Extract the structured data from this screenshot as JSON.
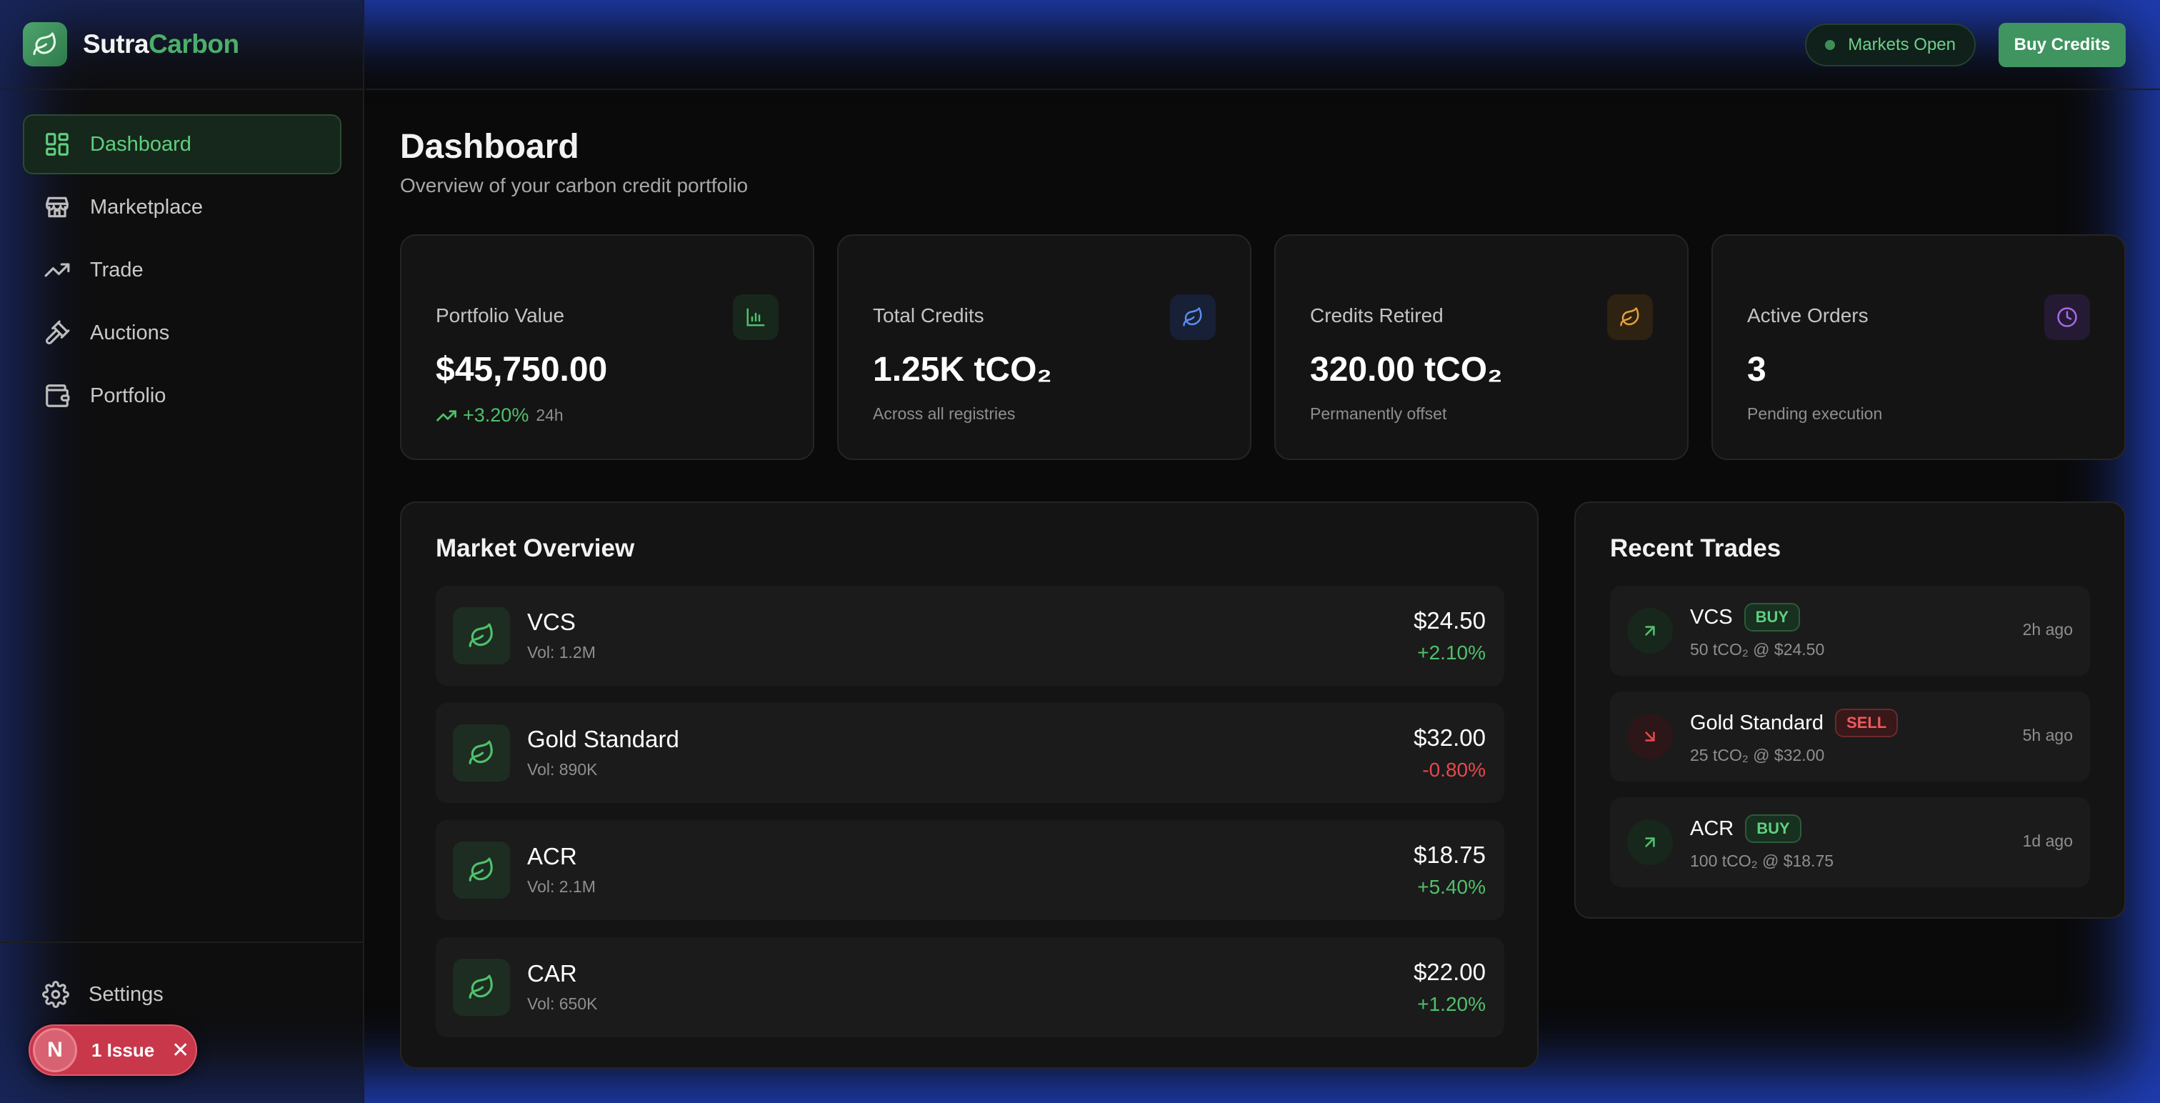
{
  "brand": {
    "name_part1": "Sutra",
    "name_part2": "Carbon"
  },
  "sidebar": {
    "items": [
      {
        "label": "Dashboard",
        "icon": "dashboard-icon",
        "active": true
      },
      {
        "label": "Marketplace",
        "icon": "store-icon",
        "active": false
      },
      {
        "label": "Trade",
        "icon": "trending-up-icon",
        "active": false
      },
      {
        "label": "Auctions",
        "icon": "gavel-icon",
        "active": false
      },
      {
        "label": "Portfolio",
        "icon": "wallet-icon",
        "active": false
      }
    ],
    "settings_label": "Settings"
  },
  "issue_badge": {
    "letter": "N",
    "label": "1 Issue",
    "close": "✕"
  },
  "topbar": {
    "market_status": "Markets Open",
    "buy_button": "Buy Credits"
  },
  "page": {
    "title": "Dashboard",
    "subtitle": "Overview of your carbon credit portfolio"
  },
  "stats": [
    {
      "label": "Portfolio Value",
      "value": "$45,750.00",
      "change": "+3.20%",
      "period": "24h",
      "icon": "bar-chart-icon",
      "color": "#4fc06b"
    },
    {
      "label": "Total Credits",
      "value": "1.25K tCO₂",
      "sub": "Across all registries",
      "icon": "leaf-icon",
      "color": "#5b8def"
    },
    {
      "label": "Credits Retired",
      "value": "320.00 tCO₂",
      "sub": "Permanently offset",
      "icon": "leaf-icon",
      "color": "#e3a23a"
    },
    {
      "label": "Active Orders",
      "value": "3",
      "sub": "Pending execution",
      "icon": "clock-icon",
      "color": "#a46ae8"
    }
  ],
  "market_overview": {
    "title": "Market Overview",
    "rows": [
      {
        "name": "VCS",
        "vol": "Vol: 1.2M",
        "price": "$24.50",
        "change": "+2.10%",
        "direction": "up"
      },
      {
        "name": "Gold Standard",
        "vol": "Vol: 890K",
        "price": "$32.00",
        "change": "-0.80%",
        "direction": "down"
      },
      {
        "name": "ACR",
        "vol": "Vol: 2.1M",
        "price": "$18.75",
        "change": "+5.40%",
        "direction": "up"
      },
      {
        "name": "CAR",
        "vol": "Vol: 650K",
        "price": "$22.00",
        "change": "+1.20%",
        "direction": "up"
      }
    ]
  },
  "recent_trades": {
    "title": "Recent Trades",
    "rows": [
      {
        "name": "VCS",
        "side": "BUY",
        "detail": "50 tCO₂ @ $24.50",
        "time": "2h ago"
      },
      {
        "name": "Gold Standard",
        "side": "SELL",
        "detail": "25 tCO₂ @ $32.00",
        "time": "5h ago"
      },
      {
        "name": "ACR",
        "side": "BUY",
        "detail": "100 tCO₂ @ $18.75",
        "time": "1d ago"
      }
    ]
  },
  "colors": {
    "accent": "#4caf6a",
    "positive": "#4fc06b",
    "negative": "#e5484d",
    "background": "#0a0a0a",
    "frame": "#1e3aa8"
  }
}
